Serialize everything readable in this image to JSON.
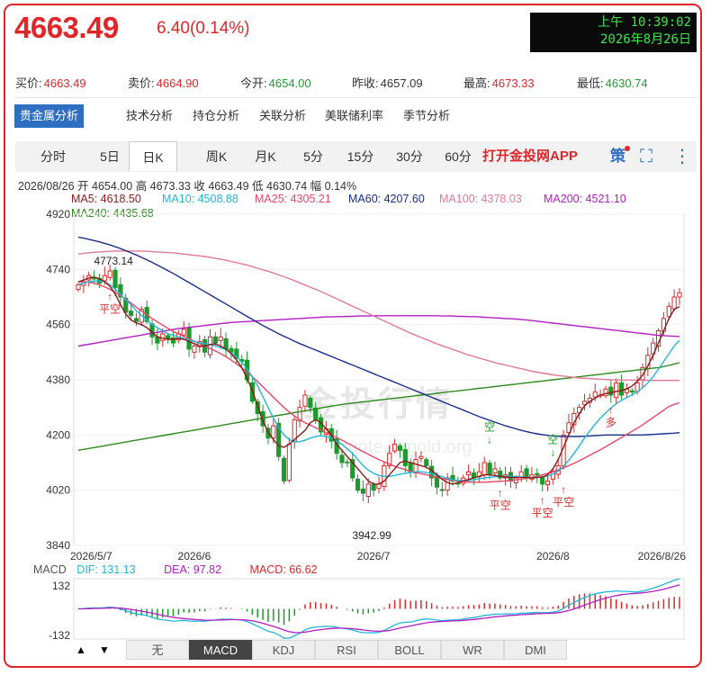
{
  "header": {
    "price": "4663.49",
    "change": "6.40(0.14%)",
    "clock_time": "上午 10:39:02",
    "clock_date": "2026年8月26日"
  },
  "quotes": [
    {
      "label": "买价:",
      "value": "4663.49",
      "color": "red"
    },
    {
      "label": "卖价:",
      "value": "4664.90",
      "color": "red"
    },
    {
      "label": "今开:",
      "value": "4654.00",
      "color": "green"
    },
    {
      "label": "昨收:",
      "value": "4657.09",
      "color": "dark"
    },
    {
      "label": "最高:",
      "value": "4673.33",
      "color": "red"
    },
    {
      "label": "最低:",
      "value": "4630.74",
      "color": "green"
    }
  ],
  "analysis_tabs": [
    "贵金属分析",
    "技术分析",
    "持仓分析",
    "关联分析",
    "美联储利率",
    "季节分析"
  ],
  "period_tabs": [
    "分时",
    "5日",
    "日K",
    "周K",
    "月K",
    "5分",
    "15分",
    "30分",
    "60分"
  ],
  "active_period": "日K",
  "app_link": "打开金投网APP",
  "info_line": {
    "date": "2026/08/26",
    "open": "开 4654.00",
    "high": "高 4673.33",
    "close": "收 4663.49",
    "low": "低 4630.74",
    "amp": "幅 0.14%"
  },
  "ma_legend": [
    {
      "text": "MA5: 4618.50",
      "color": "#8b1a1a"
    },
    {
      "text": "MA10: 4508.88",
      "color": "#22b7d8"
    },
    {
      "text": "MA25: 4305.21",
      "color": "#e8456c"
    },
    {
      "text": "MA60: 4207.60",
      "color": "#1a2e8c"
    },
    {
      "text": "MA100: 4378.03",
      "color": "#e07a96"
    },
    {
      "text": "MA200: 4521.10",
      "color": "#b020c0"
    },
    {
      "text": "MA240: 4435.68",
      "color": "#2f8a1e"
    }
  ],
  "watermark": "金投行情",
  "watermark_url": "quote.cngold.org",
  "macd_info": {
    "name": "MACD",
    "dif": "DIF: 131.13",
    "dea": "DEA: 97.82",
    "macd": "MACD: 66.62"
  },
  "indicator_buttons": [
    "无",
    "MACD",
    "KDJ",
    "RSI",
    "BOLL",
    "WR",
    "DMI"
  ],
  "active_indicator": "MACD",
  "chart_data": {
    "type": "candlestick",
    "y_ticks": [
      4920,
      4740,
      4560,
      4380,
      4200,
      4020,
      3840
    ],
    "ylim": [
      3840,
      4920
    ],
    "x_tick_labels": [
      "2026/5/7",
      "2026/6",
      "2026/7",
      "2026/8",
      "2026/8/26"
    ],
    "x_tick_index": [
      0,
      22,
      56,
      90,
      115
    ],
    "annotations": [
      {
        "text": "4773.14",
        "index": 6,
        "value": 4773.14
      },
      {
        "text": "3942.99",
        "index": 56,
        "value": 3942.99
      }
    ],
    "signals": [
      {
        "text": "平空",
        "index": 6,
        "value": 4640,
        "dir": "up"
      },
      {
        "text": "空",
        "index": 78,
        "value": 4190,
        "dir": "down"
      },
      {
        "text": "平空",
        "index": 80,
        "value": 4000,
        "dir": "up"
      },
      {
        "text": "平空",
        "index": 88,
        "value": 3975,
        "dir": "up"
      },
      {
        "text": "空",
        "index": 90,
        "value": 4150,
        "dir": "down"
      },
      {
        "text": "平空",
        "index": 92,
        "value": 4010,
        "dir": "up"
      },
      {
        "text": "多",
        "index": 101,
        "value": 4270,
        "dir": "up"
      }
    ],
    "closes": [
      4690,
      4700,
      4720,
      4710,
      4695,
      4720,
      4735,
      4680,
      4650,
      4600,
      4590,
      4570,
      4610,
      4570,
      4520,
      4500,
      4530,
      4515,
      4500,
      4530,
      4545,
      4480,
      4490,
      4505,
      4470,
      4520,
      4500,
      4520,
      4480,
      4470,
      4450,
      4440,
      4380,
      4310,
      4270,
      4230,
      4190,
      4230,
      4130,
      4050,
      4170,
      4250,
      4290,
      4330,
      4290,
      4250,
      4210,
      4220,
      4180,
      4140,
      4110,
      4110,
      4060,
      4020,
      4010,
      4040,
      4020,
      4040,
      4100,
      4140,
      4170,
      4150,
      4100,
      4080,
      4120,
      4130,
      4100,
      4060,
      4030,
      4020,
      4060,
      4050,
      4040,
      4060,
      4080,
      4060,
      4080,
      4110,
      4070,
      4090,
      4060,
      4070,
      4050,
      4060,
      4080,
      4060,
      4070,
      4070,
      4040,
      4050,
      4080,
      4100,
      4200,
      4240,
      4270,
      4290,
      4310,
      4320,
      4340,
      4330,
      4350,
      4330,
      4370,
      4330,
      4350,
      4340,
      4370,
      4420,
      4460,
      4500,
      4540,
      4580,
      4620,
      4650,
      4663.49
    ],
    "ma5": [
      4700,
      4705,
      4712,
      4715,
      4710,
      4700,
      4685,
      4660,
      4625,
      4595,
      4575,
      4565,
      4560,
      4550,
      4535,
      4520,
      4515,
      4512,
      4512,
      4515,
      4512,
      4505,
      4498,
      4490,
      4490,
      4495,
      4497,
      4490,
      4480,
      4465,
      4445,
      4420,
      4385,
      4345,
      4295,
      4245,
      4210,
      4185,
      4165,
      4160,
      4170,
      4185,
      4200,
      4215,
      4240,
      4250,
      4240,
      4220,
      4200,
      4170,
      4150,
      4130,
      4110,
      4090,
      4070,
      4050,
      4040,
      4040,
      4050,
      4070,
      4090,
      4110,
      4115,
      4110,
      4105,
      4100,
      4095,
      4085,
      4070,
      4055,
      4045,
      4040,
      4045,
      4050,
      4055,
      4060,
      4065,
      4070,
      4070,
      4068,
      4065,
      4063,
      4062,
      4062,
      4062,
      4062,
      4060,
      4062,
      4063,
      4070,
      4090,
      4120,
      4160,
      4200,
      4240,
      4270,
      4295,
      4310,
      4320,
      4330,
      4335,
      4338,
      4342,
      4345,
      4350,
      4360,
      4375,
      4395,
      4425,
      4460,
      4500,
      4540,
      4580,
      4610,
      4618.5
    ],
    "ma10": [
      4690,
      4695,
      4700,
      4702,
      4703,
      4700,
      4690,
      4675,
      4660,
      4640,
      4625,
      4605,
      4590,
      4575,
      4560,
      4550,
      4540,
      4530,
      4525,
      4520,
      4515,
      4510,
      4505,
      4500,
      4498,
      4495,
      4490,
      4485,
      4478,
      4468,
      4455,
      4438,
      4415,
      4390,
      4360,
      4325,
      4290,
      4255,
      4225,
      4200,
      4185,
      4178,
      4178,
      4183,
      4190,
      4195,
      4198,
      4195,
      4190,
      4180,
      4170,
      4155,
      4140,
      4120,
      4100,
      4085,
      4075,
      4068,
      4065,
      4065,
      4068,
      4072,
      4075,
      4078,
      4080,
      4080,
      4078,
      4074,
      4070,
      4064,
      4058,
      4054,
      4052,
      4051,
      4052,
      4054,
      4057,
      4060,
      4062,
      4064,
      4065,
      4065,
      4065,
      4064,
      4063,
      4062,
      4062,
      4062,
      4063,
      4066,
      4072,
      4082,
      4098,
      4118,
      4140,
      4165,
      4190,
      4213,
      4235,
      4255,
      4272,
      4288,
      4302,
      4313,
      4322,
      4331,
      4341,
      4354,
      4370,
      4390,
      4415,
      4440,
      4465,
      4490,
      4508.88
    ],
    "ma25": [
      4700,
      4700,
      4698,
      4695,
      4690,
      4683,
      4675,
      4665,
      4655,
      4643,
      4630,
      4617,
      4604,
      4592,
      4580,
      4569,
      4558,
      4548,
      4538,
      4530,
      4522,
      4514,
      4506,
      4498,
      4490,
      4482,
      4474,
      4465,
      4455,
      4444,
      4432,
      4419,
      4405,
      4390,
      4374,
      4357,
      4340,
      4323,
      4306,
      4290,
      4275,
      4262,
      4250,
      4240,
      4232,
      4224,
      4216,
      4208,
      4200,
      4192,
      4183,
      4174,
      4165,
      4155,
      4146,
      4137,
      4128,
      4120,
      4112,
      4105,
      4098,
      4092,
      4087,
      4082,
      4078,
      4074,
      4070,
      4066,
      4062,
      4058,
      4055,
      4052,
      4050,
      4048,
      4047,
      4046,
      4046,
      4046,
      4047,
      4048,
      4049,
      4050,
      4052,
      4054,
      4056,
      4059,
      4062,
      4066,
      4070,
      4075,
      4080,
      4086,
      4093,
      4100,
      4108,
      4116,
      4125,
      4134,
      4143,
      4152,
      4162,
      4172,
      4182,
      4192,
      4202,
      4212,
      4222,
      4233,
      4245,
      4257,
      4269,
      4281,
      4293,
      4300,
      4305.21
    ],
    "ma60": [
      4845,
      4842,
      4838,
      4834,
      4830,
      4825,
      4820,
      4814,
      4808,
      4801,
      4794,
      4787,
      4779,
      4771,
      4763,
      4754,
      4745,
      4736,
      4727,
      4717,
      4707,
      4697,
      4687,
      4677,
      4667,
      4657,
      4647,
      4637,
      4627,
      4617,
      4607,
      4597,
      4587,
      4577,
      4567,
      4557,
      4548,
      4539,
      4530,
      4522,
      4514,
      4506,
      4498,
      4491,
      4484,
      4477,
      4470,
      4463,
      4456,
      4449,
      4442,
      4435,
      4428,
      4421,
      4414,
      4407,
      4400,
      4393,
      4386,
      4379,
      4372,
      4365,
      4358,
      4351,
      4344,
      4337,
      4330,
      4323,
      4316,
      4309,
      4302,
      4295,
      4288,
      4281,
      4274,
      4267,
      4260,
      4254,
      4248,
      4242,
      4236,
      4230,
      4225,
      4220,
      4215,
      4211,
      4207,
      4204,
      4201,
      4199,
      4197,
      4196,
      4195,
      4195,
      4195,
      4195,
      4196,
      4197,
      4198,
      4199,
      4200,
      4200,
      4200,
      4200,
      4200,
      4200,
      4200,
      4200,
      4201,
      4202,
      4203,
      4204,
      4205,
      4206,
      4207.6
    ],
    "ma100": [
      4790,
      4792,
      4794,
      4796,
      4797,
      4798,
      4799,
      4800,
      4800,
      4800,
      4800,
      4800,
      4800,
      4799,
      4798,
      4797,
      4796,
      4795,
      4794,
      4792,
      4790,
      4788,
      4786,
      4784,
      4782,
      4779,
      4776,
      4773,
      4770,
      4766,
      4762,
      4758,
      4754,
      4749,
      4744,
      4739,
      4734,
      4728,
      4722,
      4716,
      4710,
      4703,
      4696,
      4689,
      4682,
      4675,
      4668,
      4660,
      4652,
      4644,
      4636,
      4628,
      4620,
      4612,
      4604,
      4596,
      4588,
      4580,
      4572,
      4564,
      4556,
      4548,
      4540,
      4532,
      4525,
      4518,
      4511,
      4504,
      4497,
      4491,
      4485,
      4479,
      4473,
      4467,
      4461,
      4456,
      4451,
      4446,
      4441,
      4436,
      4432,
      4428,
      4424,
      4420,
      4416,
      4412,
      4408,
      4405,
      4402,
      4399,
      4396,
      4394,
      4392,
      4390,
      4388,
      4386,
      4385,
      4384,
      4383,
      4382,
      4381,
      4380,
      4380,
      4379,
      4379,
      4379,
      4379,
      4378,
      4378,
      4378,
      4378,
      4378,
      4378,
      4378,
      4378.03
    ],
    "ma200": [
      4490,
      4493,
      4496,
      4499,
      4502,
      4505,
      4508,
      4511,
      4514,
      4517,
      4520,
      4523,
      4526,
      4529,
      4532,
      4535,
      4538,
      4541,
      4544,
      4547,
      4549,
      4551,
      4553,
      4555,
      4557,
      4559,
      4561,
      4563,
      4565,
      4567,
      4568,
      4569,
      4570,
      4571,
      4572,
      4573,
      4574,
      4575,
      4576,
      4577,
      4578,
      4579,
      4580,
      4581,
      4582,
      4583,
      4584,
      4585,
      4585,
      4586,
      4586,
      4587,
      4587,
      4588,
      4588,
      4588,
      4589,
      4589,
      4589,
      4589,
      4589,
      4589,
      4589,
      4589,
      4589,
      4589,
      4589,
      4589,
      4589,
      4588,
      4588,
      4588,
      4587,
      4587,
      4586,
      4586,
      4585,
      4584,
      4583,
      4582,
      4581,
      4580,
      4579,
      4578,
      4577,
      4575,
      4573,
      4571,
      4569,
      4567,
      4565,
      4563,
      4561,
      4559,
      4557,
      4555,
      4553,
      4551,
      4549,
      4547,
      4545,
      4543,
      4541,
      4539,
      4537,
      4535,
      4533,
      4531,
      4529,
      4527,
      4525,
      4524,
      4523,
      4522,
      4521.1
    ],
    "ma240": [
      4150,
      4153,
      4156,
      4159,
      4162,
      4165,
      4168,
      4171,
      4174,
      4177,
      4180,
      4183,
      4186,
      4189,
      4192,
      4195,
      4198,
      4201,
      4204,
      4207,
      4210,
      4213,
      4216,
      4219,
      4222,
      4225,
      4228,
      4231,
      4234,
      4237,
      4240,
      4243,
      4246,
      4249,
      4252,
      4255,
      4258,
      4261,
      4264,
      4267,
      4270,
      4273,
      4276,
      4279,
      4282,
      4285,
      4288,
      4291,
      4294,
      4297,
      4300,
      4302,
      4304,
      4306,
      4308,
      4310,
      4312,
      4314,
      4316,
      4318,
      4320,
      4322,
      4324,
      4326,
      4328,
      4330,
      4332,
      4334,
      4336,
      4338,
      4340,
      4342,
      4344,
      4346,
      4348,
      4350,
      4352,
      4354,
      4356,
      4358,
      4360,
      4362,
      4364,
      4366,
      4368,
      4370,
      4372,
      4374,
      4376,
      4378,
      4380,
      4382,
      4384,
      4386,
      4388,
      4390,
      4392,
      4394,
      4396,
      4398,
      4400,
      4402,
      4404,
      4406,
      4408,
      4410,
      4412,
      4414,
      4416,
      4418,
      4420,
      4423,
      4427,
      4431,
      4435.68
    ],
    "macd_ylim": [
      -132,
      132
    ],
    "macd_ticks": [
      132,
      -132
    ]
  }
}
